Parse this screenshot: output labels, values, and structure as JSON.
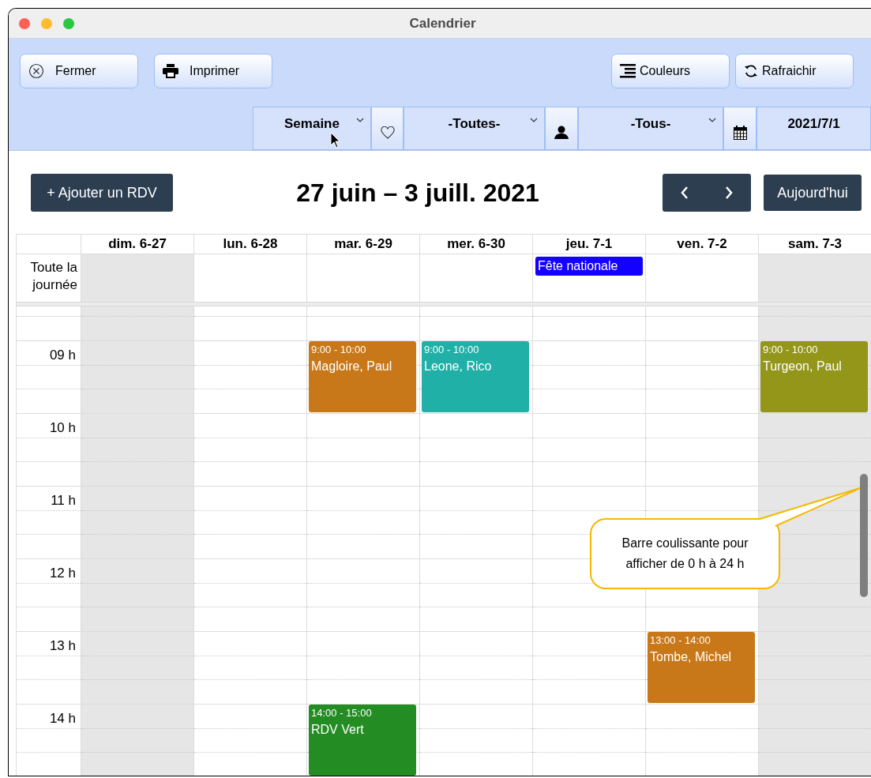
{
  "window": {
    "title": "Calendrier"
  },
  "toolbar": {
    "left_buttons": [
      {
        "label": "Fermer"
      },
      {
        "label": "Imprimer"
      }
    ],
    "right_buttons": [
      {
        "label": "Couleurs"
      },
      {
        "label": "Rafraichir"
      }
    ],
    "filters": [
      {
        "kind": "dropdown",
        "value": "Semaine"
      },
      {
        "kind": "dropdown",
        "value": "-Toutes-"
      },
      {
        "kind": "dropdown",
        "value": "-Tous-"
      },
      {
        "kind": "date",
        "value": "2021/7/1"
      }
    ]
  },
  "header": {
    "add_button": "+ Ajouter un RDV",
    "title": "27 juin – 3 juill. 2021",
    "today_button": "Aujourd'hui"
  },
  "calendar": {
    "all_day_label": "Toute la journée",
    "days": [
      {
        "label": "dim. 6-27",
        "shaded": true
      },
      {
        "label": "lun. 6-28",
        "shaded": false
      },
      {
        "label": "mar. 6-29",
        "shaded": false
      },
      {
        "label": "mer. 6-30",
        "shaded": false
      },
      {
        "label": "jeu. 7-1",
        "shaded": false,
        "all_day_events": [
          {
            "title": "Fête nationale",
            "color": "#1400ff"
          }
        ]
      },
      {
        "label": "ven. 7-2",
        "shaded": false
      },
      {
        "label": "sam. 7-3",
        "shaded": true
      }
    ],
    "hours": [
      {
        "label": "09 h",
        "cells": [
          null,
          null,
          {
            "time": "9:00 - 10:00",
            "name": "Magloire, Paul",
            "color": "#c87818"
          },
          {
            "time": "9:00 - 10:00",
            "name": "Leone, Rico",
            "color": "#20b0a8"
          },
          null,
          null,
          {
            "time": "9:00 - 10:00",
            "name": "Turgeon, Paul",
            "color": "#939619"
          }
        ]
      },
      {
        "label": "10 h",
        "cells": [
          null,
          null,
          null,
          null,
          null,
          null,
          null
        ]
      },
      {
        "label": "11 h",
        "cells": [
          null,
          null,
          null,
          null,
          null,
          null,
          null
        ]
      },
      {
        "label": "12 h",
        "cells": [
          null,
          null,
          null,
          null,
          null,
          null,
          null
        ]
      },
      {
        "label": "13 h",
        "cells": [
          null,
          null,
          null,
          null,
          null,
          {
            "time": "13:00 - 14:00",
            "name": "Tombe, Michel",
            "color": "#c87818"
          },
          null
        ]
      },
      {
        "label": "14 h",
        "cells": [
          null,
          null,
          {
            "time": "14:00 - 15:00",
            "name": "RDV Vert",
            "color": "#238c23"
          },
          null,
          null,
          null,
          null
        ]
      }
    ]
  },
  "callout": {
    "text": "Barre coulissante pour afficher de 0 h à 24 h"
  }
}
